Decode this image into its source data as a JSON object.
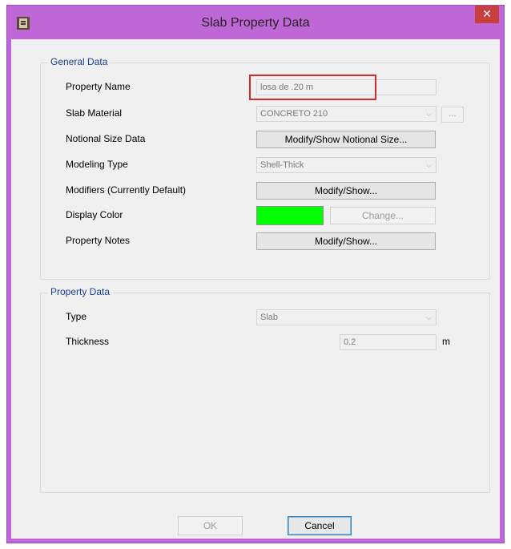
{
  "window": {
    "title": "Slab Property Data",
    "close_glyph": "✕"
  },
  "general": {
    "legend": "General Data",
    "property_name": {
      "label": "Property Name",
      "value": "losa de .20 m"
    },
    "slab_material": {
      "label": "Slab Material",
      "value": "CONCRETO 210",
      "ellipsis": "..."
    },
    "notional": {
      "label": "Notional Size Data",
      "button": "Modify/Show Notional Size..."
    },
    "modeling_type": {
      "label": "Modeling Type",
      "value": "Shell-Thick"
    },
    "modifiers": {
      "label": "Modifiers (Currently Default)",
      "button": "Modify/Show..."
    },
    "display_color": {
      "label": "Display Color",
      "color": "#00ff00",
      "button": "Change..."
    },
    "notes": {
      "label": "Property Notes",
      "button": "Modify/Show..."
    }
  },
  "property": {
    "legend": "Property Data",
    "type": {
      "label": "Type",
      "value": "Slab"
    },
    "thickness": {
      "label": "Thickness",
      "value": "0.2",
      "unit": "m"
    }
  },
  "buttons": {
    "ok": "OK",
    "cancel": "Cancel"
  },
  "icons": {
    "app": "etabs-app-icon",
    "chevron": "chevron-down-icon",
    "close": "close-icon"
  },
  "colors": {
    "titlebar": "#c067d8",
    "close": "#c8403b",
    "legend": "#1a3f99",
    "highlight": "#d22b2b"
  }
}
